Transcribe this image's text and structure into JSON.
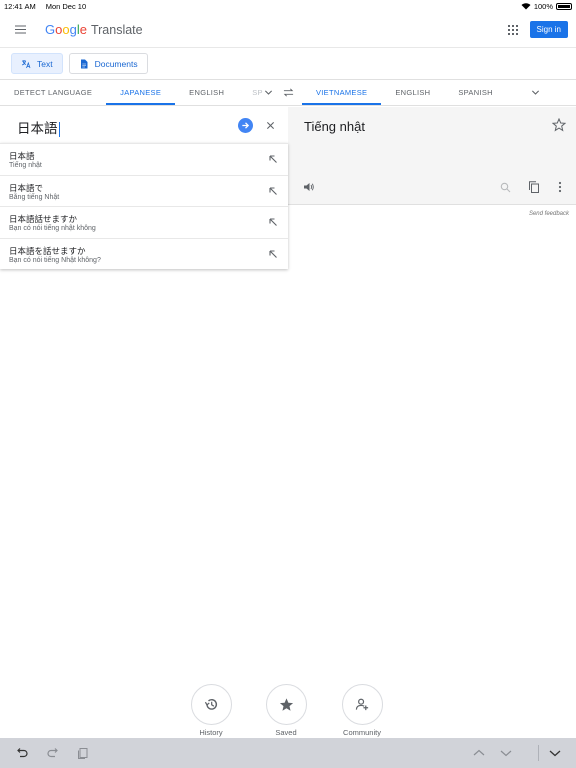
{
  "status_bar": {
    "time": "12:41 AM",
    "date": "Mon Dec 10",
    "battery": "100%"
  },
  "app_bar": {
    "logo_letters": [
      "G",
      "o",
      "o",
      "g",
      "l",
      "e"
    ],
    "product": "Translate",
    "sign_in_label": "Sign in"
  },
  "modes": {
    "text_label": "Text",
    "documents_label": "Documents"
  },
  "source_languages": [
    "DETECT LANGUAGE",
    "JAPANESE",
    "ENGLISH",
    "SP"
  ],
  "target_languages": [
    "VIETNAMESE",
    "ENGLISH",
    "SPANISH"
  ],
  "selected_source": "JAPANESE",
  "selected_target": "VIETNAMESE",
  "source": {
    "text": "日本語"
  },
  "target": {
    "text": "Tiếng nhật"
  },
  "feedback_label": "Send feedback",
  "suggestions": [
    {
      "text": "日本語",
      "translation": "Tiếng nhật"
    },
    {
      "text": "日本語で",
      "translation": "Bằng tiếng Nhật"
    },
    {
      "text": "日本語話せますか",
      "translation": "Bạn có nói tiếng nhật không"
    },
    {
      "text": "日本語を話せますか",
      "translation": "Bạn có nói tiếng Nhật không?"
    }
  ],
  "shortcuts": {
    "history": "History",
    "saved": "Saved",
    "community": "Community"
  },
  "colors": {
    "accent": "#1a73e8",
    "go_button": "#4285f4",
    "keyboard_bar": "#d1d3d9"
  }
}
